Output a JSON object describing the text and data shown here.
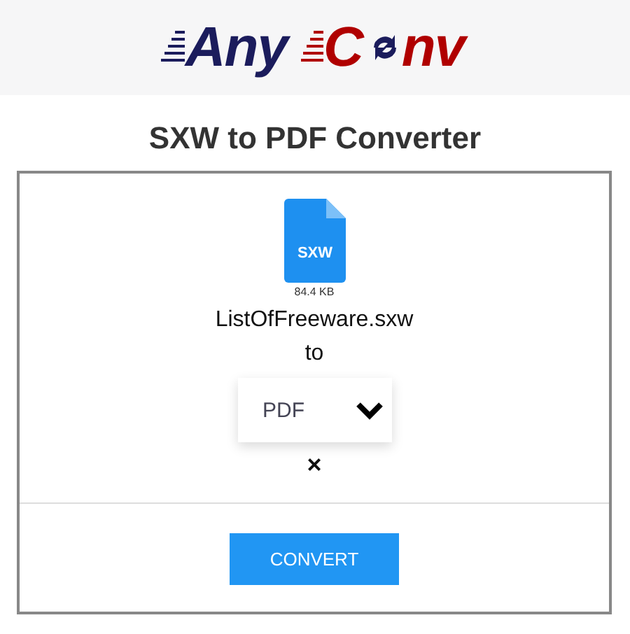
{
  "logo": {
    "first": "Any",
    "second_start": "C",
    "second_end": "nv"
  },
  "title": "SXW to PDF Converter",
  "file": {
    "extension": "SXW",
    "size": "84.4 KB",
    "name": "ListOfFreeware.sxw"
  },
  "to_label": "to",
  "format_select": {
    "value": "PDF"
  },
  "remove": "×",
  "convert_button": "CONVERT"
}
